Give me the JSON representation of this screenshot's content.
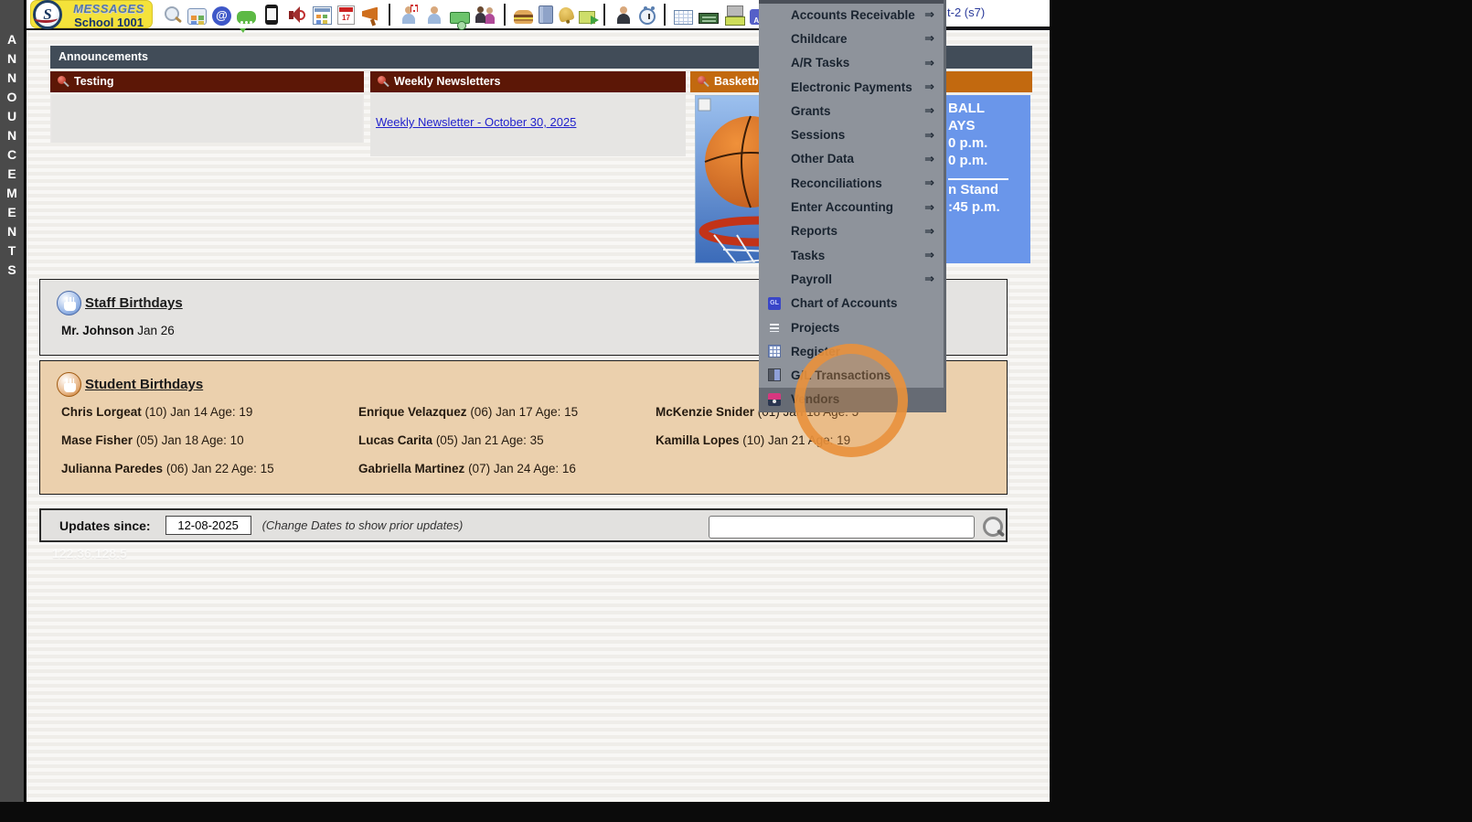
{
  "app": {
    "logo_title": "MESSAGES",
    "logo_subtitle": "School 1001",
    "logo_monogram": "S",
    "session_label": "t-2 (s7)",
    "vertical_tab": "ANNOUNCEMENTS",
    "watermark": "122.36.128.5"
  },
  "toolbar": {
    "at_symbol": "@",
    "calendar_day": "17",
    "ap_label": "A/P",
    "icons": [
      "search",
      "dashboard-grid",
      "email-at",
      "chat-bubble",
      "mobile-phone",
      "speaker",
      "schedule-calendar",
      "date-calendar",
      "megaphone",
      "nurse",
      "staff-member",
      "money",
      "family",
      "lunch-burger",
      "binder",
      "bell",
      "send-note",
      "admin-person",
      "alarm-clock",
      "ledger-table",
      "check-card",
      "check-printer",
      "accounts-payable",
      "pdf-file",
      "cash-register"
    ]
  },
  "menu": {
    "arrow": "⇒",
    "submenu_items": [
      "Accounts Receivable",
      "Childcare",
      "A/R Tasks",
      "Electronic Payments",
      "Grants",
      "Sessions",
      "Other Data",
      "Reconciliations",
      "Enter Accounting",
      "Reports",
      "Tasks",
      "Payroll"
    ],
    "leaf_items": [
      {
        "label": "Chart of Accounts",
        "icon_text": "GL"
      },
      {
        "label": "Projects"
      },
      {
        "label": "Register"
      },
      {
        "label": "G/L Transactions"
      },
      {
        "label": "Vendors",
        "highlighted": true
      }
    ]
  },
  "announcements": {
    "section_title": "Announcements",
    "panels": [
      {
        "title": "Testing"
      },
      {
        "title": "Weekly Newsletters",
        "link_text": "Weekly Newsletter - October 30, 2025"
      },
      {
        "title": "Basketball",
        "info_lines": [
          "BALL",
          "AYS",
          "0 p.m.",
          "0 p.m.",
          "n Stand",
          ":45 p.m."
        ]
      }
    ]
  },
  "staff_birthdays": {
    "title": "Staff Birthdays",
    "entries": [
      {
        "name": "Mr. Johnson",
        "detail": "Jan 26"
      }
    ]
  },
  "student_birthdays": {
    "title": "Student Birthdays",
    "entries": [
      {
        "name": "Chris Lorgeat",
        "detail": "(10) Jan 14 Age: 19"
      },
      {
        "name": "Enrique Velazquez",
        "detail": "(06) Jan 17 Age: 15"
      },
      {
        "name": "McKenzie Snider",
        "detail": "(01) Jan 18 Age: 5"
      },
      {
        "name": "Mase Fisher",
        "detail": "(05) Jan 18 Age: 10"
      },
      {
        "name": "Lucas Carita",
        "detail": "(05) Jan 21 Age: 35"
      },
      {
        "name": "Kamilla Lopes",
        "detail": "(10) Jan 21 Age: 19"
      },
      {
        "name": "Julianna Paredes",
        "detail": "(06) Jan 22 Age: 15"
      },
      {
        "name": "Gabriella Martinez",
        "detail": "(07) Jan 24 Age: 16"
      }
    ]
  },
  "updates": {
    "label": "Updates since:",
    "date_value": "12-08-2025",
    "note": "(Change Dates to show prior updates)",
    "search_value": ""
  },
  "colors": {
    "maroon_header": "#5c1706",
    "orange_header": "#c2690f",
    "section_header": "#414c58",
    "menu_bg": "#8e939b",
    "menu_highlight": "#666b74",
    "info_panel_blue": "#6a96ea",
    "student_panel": "#ebd0ad",
    "click_ring": "#e8923c",
    "link_blue": "#2222cc",
    "logo_yellow": "#f4e23a"
  }
}
